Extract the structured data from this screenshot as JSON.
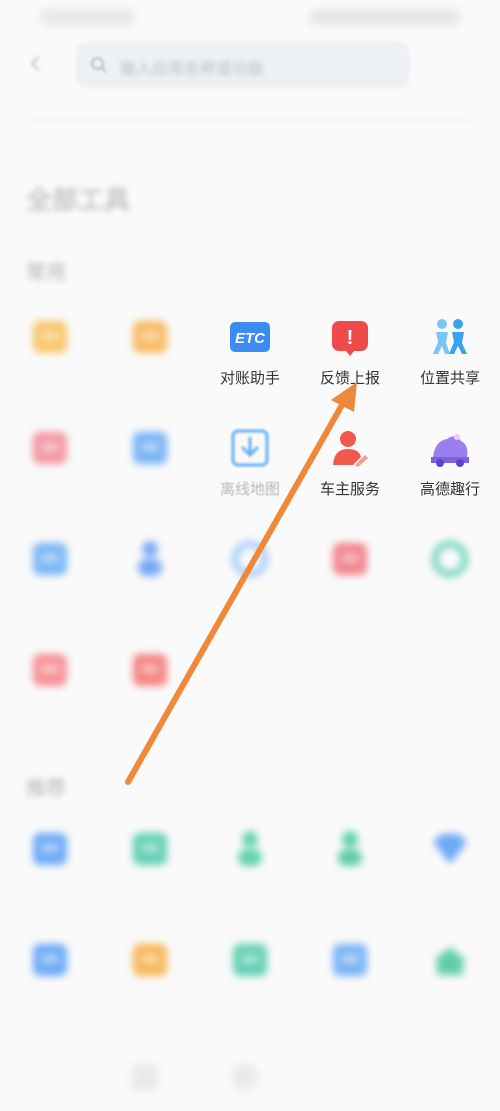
{
  "status_bar": {
    "left": "",
    "right": ""
  },
  "header": {
    "back_label": "‹",
    "search_placeholder": "输入应用名称或功能"
  },
  "page_title": "全部工具",
  "section1": {
    "title": "常用",
    "rows": [
      [
        {
          "label": "",
          "icon": "bag-icon",
          "color": "#f9b43a"
        },
        {
          "label": "",
          "icon": "wallet-icon",
          "color": "#f7a531"
        },
        {
          "label": "对账助手",
          "icon": "etc-icon",
          "color": "#3b8cf2",
          "icon_text": "ETC"
        },
        {
          "label": "反馈上报",
          "icon": "alert-icon",
          "color": "#ef4b4b",
          "icon_text": "!"
        },
        {
          "label": "位置共享",
          "icon": "people-icon",
          "color": "#3aa3f0"
        }
      ],
      [
        {
          "label": "",
          "icon": "thermometer-icon",
          "color": "#f07585"
        },
        {
          "label": "",
          "icon": "camera-icon",
          "color": "#4b9bf5"
        },
        {
          "label": "离线地图",
          "icon": "download-map-icon",
          "color": "#58a6f4"
        },
        {
          "label": "车主服务",
          "icon": "user-icon",
          "color": "#ef5a4d"
        },
        {
          "label": "高德趣行",
          "icon": "car-icon",
          "color": "#9b7ff0"
        }
      ],
      [
        {
          "label": "",
          "icon": "document-icon",
          "color": "#4da0f3"
        },
        {
          "label": "",
          "icon": "person-icon",
          "color": "#4a8ef0"
        },
        {
          "label": "",
          "icon": "globe-icon",
          "color": "#7bb6f4"
        },
        {
          "label": "",
          "icon": "heart-box-icon",
          "color": "#ee5d67"
        },
        {
          "label": "",
          "icon": "headset-icon",
          "color": "#33c3a3"
        }
      ],
      [
        {
          "label": "",
          "icon": "ticket-icon",
          "color": "#f36d73"
        },
        {
          "label": "",
          "icon": "notebook-icon",
          "color": "#f25b5b"
        }
      ]
    ]
  },
  "section2": {
    "title": "推荐",
    "rows": [
      [
        {
          "label": "",
          "icon": "card-icon",
          "color": "#3d8ef5"
        },
        {
          "label": "",
          "icon": "tv-icon",
          "color": "#2fc19a"
        },
        {
          "label": "",
          "icon": "walker-icon",
          "color": "#32c497"
        },
        {
          "label": "",
          "icon": "run-icon",
          "color": "#2bbf8d"
        },
        {
          "label": "",
          "icon": "diamond-icon",
          "color": "#3d8ef5"
        }
      ],
      [
        {
          "label": "",
          "icon": "flag-icon",
          "color": "#3d8ef5"
        },
        {
          "label": "",
          "icon": "folder-icon",
          "color": "#f6a024"
        },
        {
          "label": "",
          "icon": "photo-icon",
          "color": "#2fc19a"
        },
        {
          "label": "",
          "icon": "chat-icon",
          "color": "#4b9cf3"
        },
        {
          "label": "",
          "icon": "house-icon",
          "color": "#2fbf8c"
        }
      ]
    ]
  },
  "annotation": {
    "color": "#f0883a"
  }
}
